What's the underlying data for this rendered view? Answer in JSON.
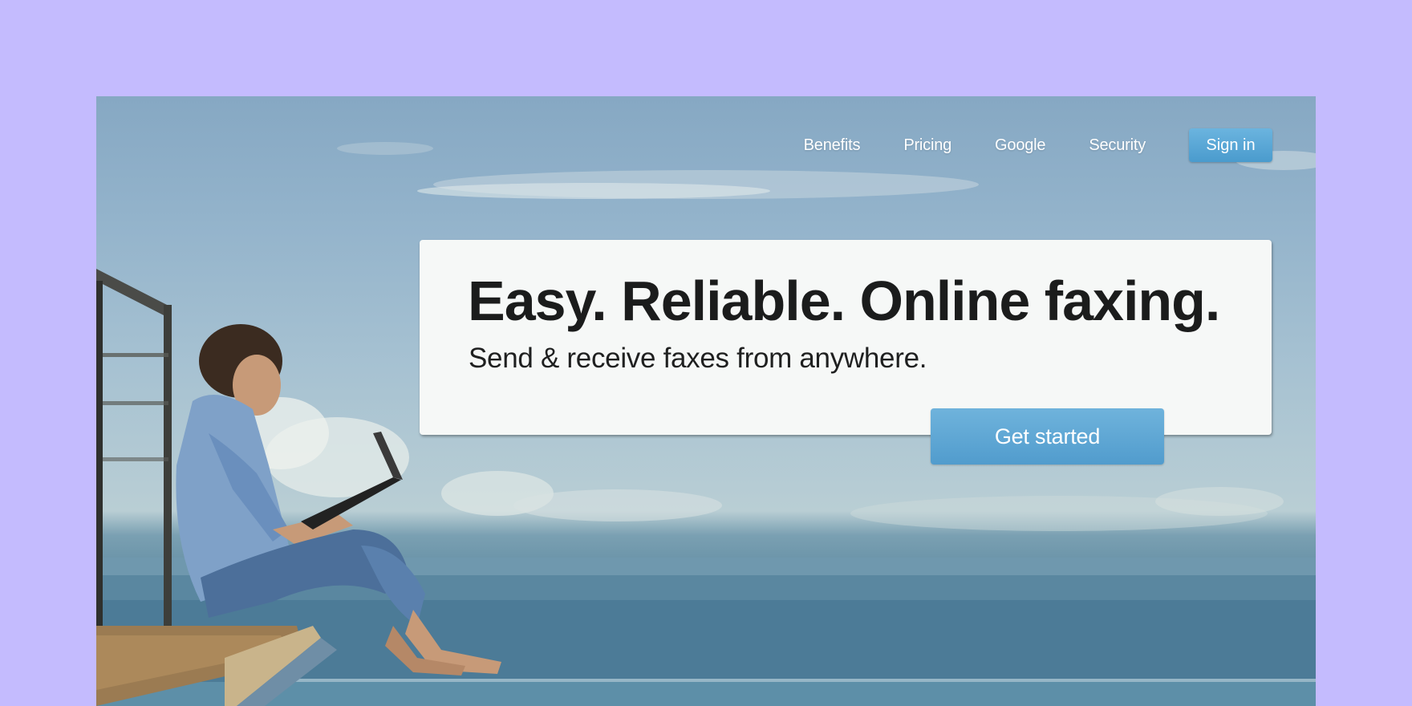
{
  "nav": {
    "items": [
      {
        "label": "Benefits"
      },
      {
        "label": "Pricing"
      },
      {
        "label": "Google"
      },
      {
        "label": "Security"
      }
    ],
    "signin_label": "Sign in"
  },
  "hero": {
    "headline": "Easy. Reliable. Online faxing.",
    "subheadline": "Send & receive faxes from anywhere.",
    "cta_label": "Get started"
  },
  "colors": {
    "page_background": "#c4bbfe",
    "button_blue": "#5aa6d6",
    "card_background": "#f6f8f7"
  }
}
